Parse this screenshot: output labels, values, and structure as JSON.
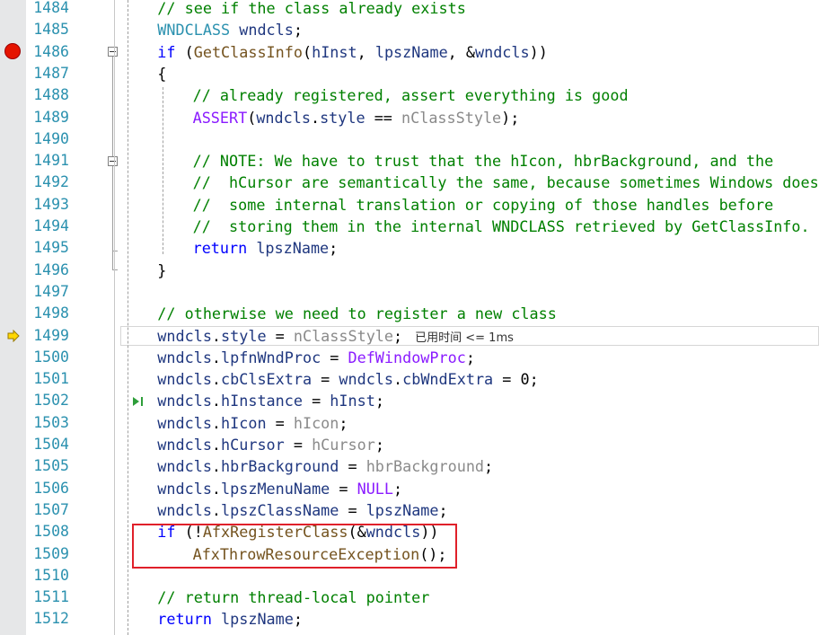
{
  "editor": {
    "lines": [
      {
        "n": "1484",
        "ind": 1,
        "tokens": [
          {
            "c": "c",
            "t": "// see if the class already exists"
          }
        ]
      },
      {
        "n": "1485",
        "ind": 1,
        "tokens": [
          {
            "c": "t",
            "t": "WNDCLASS"
          },
          {
            "c": "",
            "t": " "
          },
          {
            "c": "v",
            "t": "wndcls"
          },
          {
            "c": "",
            "t": ";"
          }
        ]
      },
      {
        "n": "1486",
        "ind": 1,
        "tokens": [
          {
            "c": "k",
            "t": "if"
          },
          {
            "c": "",
            "t": " ("
          },
          {
            "c": "f",
            "t": "GetClassInfo"
          },
          {
            "c": "",
            "t": "("
          },
          {
            "c": "v",
            "t": "hInst"
          },
          {
            "c": "",
            "t": ", "
          },
          {
            "c": "v",
            "t": "lpszName"
          },
          {
            "c": "",
            "t": ", &"
          },
          {
            "c": "v",
            "t": "wndcls"
          },
          {
            "c": "",
            "t": "))"
          }
        ]
      },
      {
        "n": "1487",
        "ind": 1,
        "tokens": [
          {
            "c": "",
            "t": "{"
          }
        ]
      },
      {
        "n": "1488",
        "ind": 2,
        "tokens": [
          {
            "c": "c",
            "t": "// already registered, assert everything is good"
          }
        ]
      },
      {
        "n": "1489",
        "ind": 2,
        "tokens": [
          {
            "c": "m",
            "t": "ASSERT"
          },
          {
            "c": "",
            "t": "("
          },
          {
            "c": "v",
            "t": "wndcls"
          },
          {
            "c": "",
            "t": "."
          },
          {
            "c": "v",
            "t": "style"
          },
          {
            "c": "",
            "t": " == "
          },
          {
            "c": "cv",
            "t": "nClassStyle"
          },
          {
            "c": "",
            "t": ");"
          }
        ]
      },
      {
        "n": "1490",
        "ind": 0,
        "tokens": []
      },
      {
        "n": "1491",
        "ind": 2,
        "tokens": [
          {
            "c": "c",
            "t": "// NOTE: We have to trust that the hIcon, hbrBackground, and the"
          }
        ]
      },
      {
        "n": "1492",
        "ind": 2,
        "tokens": [
          {
            "c": "c",
            "t": "//  hCursor are semantically the same, because sometimes Windows does"
          }
        ]
      },
      {
        "n": "1493",
        "ind": 2,
        "tokens": [
          {
            "c": "c",
            "t": "//  some internal translation or copying of those handles before"
          }
        ]
      },
      {
        "n": "1494",
        "ind": 2,
        "tokens": [
          {
            "c": "c",
            "t": "//  storing them in the internal WNDCLASS retrieved by GetClassInfo."
          }
        ]
      },
      {
        "n": "1495",
        "ind": 2,
        "tokens": [
          {
            "c": "k",
            "t": "return"
          },
          {
            "c": "",
            "t": " "
          },
          {
            "c": "v",
            "t": "lpszName"
          },
          {
            "c": "",
            "t": ";"
          }
        ]
      },
      {
        "n": "1496",
        "ind": 1,
        "tokens": [
          {
            "c": "",
            "t": "}"
          }
        ]
      },
      {
        "n": "1497",
        "ind": 0,
        "tokens": []
      },
      {
        "n": "1498",
        "ind": 1,
        "tokens": [
          {
            "c": "c",
            "t": "// otherwise we need to register a new class"
          }
        ]
      },
      {
        "n": "1499",
        "ind": 1,
        "tokens": [
          {
            "c": "v",
            "t": "wndcls"
          },
          {
            "c": "",
            "t": "."
          },
          {
            "c": "v",
            "t": "style"
          },
          {
            "c": "",
            "t": " = "
          },
          {
            "c": "cv",
            "t": "nClassStyle"
          },
          {
            "c": "",
            "t": ";"
          }
        ],
        "tip": "已用时间 <= 1ms"
      },
      {
        "n": "1500",
        "ind": 1,
        "tokens": [
          {
            "c": "v",
            "t": "wndcls"
          },
          {
            "c": "",
            "t": "."
          },
          {
            "c": "v",
            "t": "lpfnWndProc"
          },
          {
            "c": "",
            "t": " = "
          },
          {
            "c": "m",
            "t": "DefWindowProc"
          },
          {
            "c": "",
            "t": ";"
          }
        ]
      },
      {
        "n": "1501",
        "ind": 1,
        "tokens": [
          {
            "c": "v",
            "t": "wndcls"
          },
          {
            "c": "",
            "t": "."
          },
          {
            "c": "v",
            "t": "cbClsExtra"
          },
          {
            "c": "",
            "t": " = "
          },
          {
            "c": "v",
            "t": "wndcls"
          },
          {
            "c": "",
            "t": "."
          },
          {
            "c": "v",
            "t": "cbWndExtra"
          },
          {
            "c": "",
            "t": " = 0;"
          }
        ]
      },
      {
        "n": "1502",
        "ind": 1,
        "tokens": [
          {
            "c": "v",
            "t": "wndcls"
          },
          {
            "c": "",
            "t": "."
          },
          {
            "c": "v",
            "t": "hInstance"
          },
          {
            "c": "",
            "t": " = "
          },
          {
            "c": "v",
            "t": "hInst"
          },
          {
            "c": "",
            "t": ";"
          }
        ]
      },
      {
        "n": "1503",
        "ind": 1,
        "tokens": [
          {
            "c": "v",
            "t": "wndcls"
          },
          {
            "c": "",
            "t": "."
          },
          {
            "c": "v",
            "t": "hIcon"
          },
          {
            "c": "",
            "t": " = "
          },
          {
            "c": "cv",
            "t": "hIcon"
          },
          {
            "c": "",
            "t": ";"
          }
        ]
      },
      {
        "n": "1504",
        "ind": 1,
        "tokens": [
          {
            "c": "v",
            "t": "wndcls"
          },
          {
            "c": "",
            "t": "."
          },
          {
            "c": "v",
            "t": "hCursor"
          },
          {
            "c": "",
            "t": " = "
          },
          {
            "c": "cv",
            "t": "hCursor"
          },
          {
            "c": "",
            "t": ";"
          }
        ]
      },
      {
        "n": "1505",
        "ind": 1,
        "tokens": [
          {
            "c": "v",
            "t": "wndcls"
          },
          {
            "c": "",
            "t": "."
          },
          {
            "c": "v",
            "t": "hbrBackground"
          },
          {
            "c": "",
            "t": " = "
          },
          {
            "c": "cv",
            "t": "hbrBackground"
          },
          {
            "c": "",
            "t": ";"
          }
        ]
      },
      {
        "n": "1506",
        "ind": 1,
        "tokens": [
          {
            "c": "v",
            "t": "wndcls"
          },
          {
            "c": "",
            "t": "."
          },
          {
            "c": "v",
            "t": "lpszMenuName"
          },
          {
            "c": "",
            "t": " = "
          },
          {
            "c": "m",
            "t": "NULL"
          },
          {
            "c": "",
            "t": ";"
          }
        ]
      },
      {
        "n": "1507",
        "ind": 1,
        "tokens": [
          {
            "c": "v",
            "t": "wndcls"
          },
          {
            "c": "",
            "t": "."
          },
          {
            "c": "v",
            "t": "lpszClassName"
          },
          {
            "c": "",
            "t": " = "
          },
          {
            "c": "v",
            "t": "lpszName"
          },
          {
            "c": "",
            "t": ";"
          }
        ]
      },
      {
        "n": "1508",
        "ind": 1,
        "tokens": [
          {
            "c": "k",
            "t": "if"
          },
          {
            "c": "",
            "t": " (!"
          },
          {
            "c": "f",
            "t": "AfxRegisterClass"
          },
          {
            "c": "",
            "t": "(&"
          },
          {
            "c": "v",
            "t": "wndcls"
          },
          {
            "c": "",
            "t": "))"
          }
        ]
      },
      {
        "n": "1509",
        "ind": 2,
        "tokens": [
          {
            "c": "f",
            "t": "AfxThrowResourceException"
          },
          {
            "c": "",
            "t": "();"
          }
        ]
      },
      {
        "n": "1510",
        "ind": 0,
        "tokens": []
      },
      {
        "n": "1511",
        "ind": 1,
        "tokens": [
          {
            "c": "c",
            "t": "// return thread-local pointer"
          }
        ]
      },
      {
        "n": "1512",
        "ind": 1,
        "tokens": [
          {
            "c": "k",
            "t": "return"
          },
          {
            "c": "",
            "t": " "
          },
          {
            "c": "v",
            "t": "lpszName"
          },
          {
            "c": "",
            "t": ";"
          }
        ]
      }
    ]
  },
  "colors": {
    "comment": "#008000",
    "keyword": "#0000ff",
    "type": "#2b91af",
    "function": "#74531f",
    "variable": "#1f377f",
    "macro": "#8a1bff",
    "param": "#8a8a8a",
    "line_number": "#2b91af",
    "breakpoint": "#e51400",
    "highlight_box": "#e0202a"
  },
  "icons": {
    "breakpoint": "breakpoint-icon",
    "current_statement": "current-statement-arrow-icon",
    "run_to_click": "run-to-click-icon",
    "collapse": "collapse-icon"
  }
}
